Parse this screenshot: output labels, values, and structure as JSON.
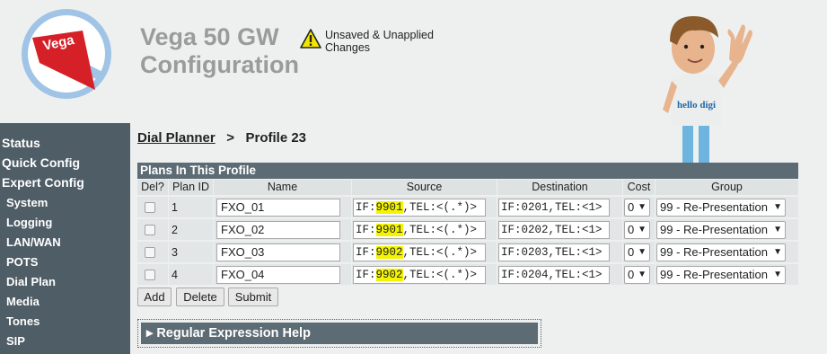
{
  "header": {
    "title_line1": "Vega 50 GW",
    "title_line2": "Configuration",
    "warning_line1": "Unsaved & Unapplied",
    "warning_line2": "Changes",
    "logo_text": "Vega",
    "mascot_text": "hello digi"
  },
  "sidebar": {
    "items": [
      {
        "label": "Status"
      },
      {
        "label": "Quick Config"
      },
      {
        "label": "Expert Config"
      },
      {
        "label": "System"
      },
      {
        "label": "Logging"
      },
      {
        "label": "LAN/WAN"
      },
      {
        "label": "POTS"
      },
      {
        "label": "Dial Plan"
      },
      {
        "label": "Media"
      },
      {
        "label": "Tones"
      },
      {
        "label": "SIP"
      }
    ]
  },
  "breadcrumb": {
    "link": "Dial Planner",
    "separator": ">",
    "current": "Profile 23"
  },
  "table": {
    "title": "Plans In This Profile",
    "columns": [
      "Del?",
      "Plan ID",
      "Name",
      "Source",
      "Destination",
      "Cost",
      "Group"
    ],
    "rows": [
      {
        "id": "1",
        "name": "FXO_01",
        "source_pre": "IF:",
        "source_hl": "9901",
        "source_post": ",TEL:<(.*)>",
        "dest": "IF:0201,TEL:<1>",
        "cost": "0",
        "group": "99 - Re-Presentation"
      },
      {
        "id": "2",
        "name": "FXO_02",
        "source_pre": "IF:",
        "source_hl": "9901",
        "source_post": ",TEL:<(.*)>",
        "dest": "IF:0202,TEL:<1>",
        "cost": "0",
        "group": "99 - Re-Presentation"
      },
      {
        "id": "3",
        "name": "FXO_03",
        "source_pre": "IF:",
        "source_hl": "9902",
        "source_post": ",TEL:<(.*)>",
        "dest": "IF:0203,TEL:<1>",
        "cost": "0",
        "group": "99 - Re-Presentation"
      },
      {
        "id": "4",
        "name": "FXO_04",
        "source_pre": "IF:",
        "source_hl": "9902",
        "source_post": ",TEL:<(.*)>",
        "dest": "IF:0204,TEL:<1>",
        "cost": "0",
        "group": "99 - Re-Presentation"
      }
    ]
  },
  "buttons": {
    "add": "Add",
    "delete": "Delete",
    "submit": "Submit"
  },
  "regex_help": {
    "label": "Regular Expression Help"
  },
  "colors": {
    "sidebar": "#4f5d66",
    "header_bar": "#5c6b74",
    "highlight": "#f4f400",
    "logo_red": "#d62027"
  }
}
